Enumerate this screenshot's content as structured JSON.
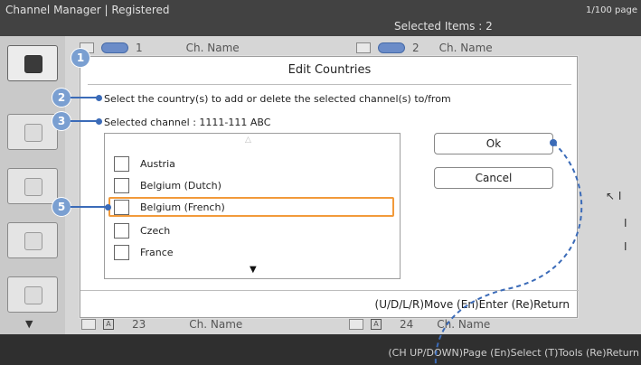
{
  "topbar": {
    "title": "Channel Manager | Registered",
    "page_indicator": "1/100 page",
    "selected_items": "Selected Items : 2"
  },
  "channels_header": [
    {
      "number": "1",
      "name": "Ch. Name"
    },
    {
      "number": "2",
      "name": "Ch. Name"
    }
  ],
  "channels_footer": [
    {
      "badge": "A",
      "number": "23",
      "name": "Ch. Name"
    },
    {
      "badge": "A",
      "number": "24",
      "name": "Ch. Name"
    }
  ],
  "side_down_arrow": "▼",
  "bottom_help": "(CH UP/DOWN)Page  (En)Select  (T)Tools  (Re)Return",
  "dialog": {
    "title": "Edit Countries",
    "instruction": "Select the country(s) to add or delete the selected channel(s) to/from",
    "selected_channel": "Selected channel : 1111-111 ABC",
    "list_up_arrow": "△",
    "list_down_arrow": "▼",
    "countries": [
      "Austria",
      "Belgium (Dutch)",
      "Belgium (French)",
      "Czech",
      "France"
    ],
    "highlighted_index": 2,
    "ok_label": "Ok",
    "cancel_label": "Cancel",
    "footer_help": "(U/D/L/R)Move  (En)Enter  (Re)Return"
  },
  "callouts": [
    "1",
    "2",
    "3",
    "5"
  ],
  "colors": {
    "callout": "#7a9fd1",
    "leader": "#3b6bb8",
    "highlight": "#f29a3a"
  }
}
